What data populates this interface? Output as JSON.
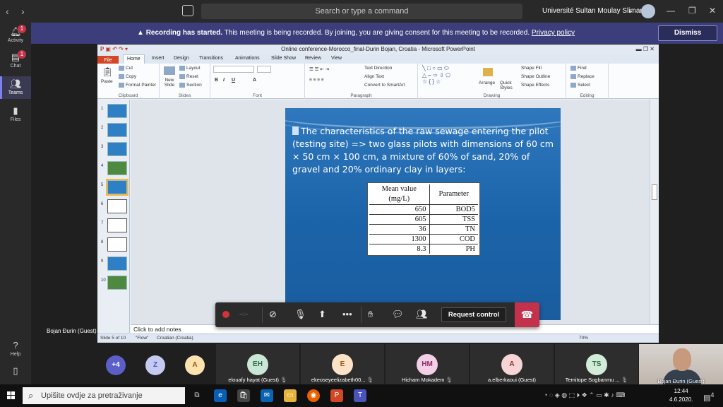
{
  "teams": {
    "search_placeholder": "Search or type a command",
    "org_name": "Université Sultan Moulay Slimane",
    "rail": [
      {
        "label": "Activity",
        "badge": "1"
      },
      {
        "label": "Chat",
        "badge": "1"
      },
      {
        "label": "Teams",
        "badge": ""
      },
      {
        "label": "Files",
        "badge": ""
      },
      {
        "label": "Help",
        "badge": ""
      }
    ]
  },
  "banner": {
    "bold": "Recording has started.",
    "text": "This meeting is being recorded. By joining, you are giving consent for this meeting to be recorded.",
    "link": "Privacy policy",
    "dismiss": "Dismiss"
  },
  "powerpoint": {
    "title": "Online conference-Morocco_final-Durin Bojan, Croatia  -  Microsoft PowerPoint",
    "tabs": [
      "File",
      "Home",
      "Insert",
      "Design",
      "Transitions",
      "Animations",
      "Slide Show",
      "Review",
      "View"
    ],
    "groups": {
      "clipboard": "Clipboard",
      "slides": "Slides",
      "font": "Font",
      "paragraph": "Paragraph",
      "drawing": "Drawing",
      "editing": "Editing"
    },
    "buttons": {
      "paste": "Paste",
      "cut": "Cut",
      "copy": "Copy",
      "format_painter": "Format Painter",
      "new_slide": "New Slide",
      "layout": "Layout",
      "reset": "Reset",
      "section": "Section",
      "text_direction": "Text Direction",
      "align_text": "Align Text",
      "convert_smartart": "Convert to SmartArt",
      "arrange": "Arrange",
      "quick_styles": "Quick Styles",
      "shape_fill": "Shape Fill",
      "shape_outline": "Shape Outline",
      "shape_effects": "Shape Effects",
      "find": "Find",
      "replace": "Replace",
      "select": "Select"
    },
    "slide_numbers": [
      "1",
      "2",
      "3",
      "4",
      "5",
      "6",
      "7",
      "8",
      "9",
      "10"
    ],
    "slide": {
      "text": "The characteristics of the raw sewage entering the pilot (testing site) => two glass pilots with dimensions of 60 cm × 50 cm × 100 cm, a mixture of 60% of sand, 20% of gravel and 20% ordinary clay in layers:",
      "table_headers": [
        "Mean value (mg/L)",
        "Parameter"
      ],
      "table_rows": [
        {
          "value": "650",
          "parameter": "BOD5"
        },
        {
          "value": "605",
          "parameter": "TSS"
        },
        {
          "value": "36",
          "parameter": "TN"
        },
        {
          "value": "1300",
          "parameter": "COD"
        },
        {
          "value": "8.3",
          "parameter": "PH"
        }
      ]
    },
    "notes_placeholder": "Click to add notes",
    "status": {
      "slide_of": "Slide 5 of 10",
      "theme": "\"Flow\"",
      "language": "Croatian (Croatia)",
      "zoom": "70%"
    }
  },
  "call": {
    "timer": "--:--",
    "request_control": "Request control",
    "presenter_name": "Bojan Đurin (Guest)"
  },
  "participants": {
    "overflow": "+4",
    "chips": [
      {
        "initials": "Z",
        "color": "#c5cbf0"
      },
      {
        "initials": "A",
        "color": "#fde2b0"
      }
    ],
    "tiles": [
      {
        "initials": "EH",
        "name": "elouafy hayat (Guest)",
        "color": "#c9e6d6"
      },
      {
        "initials": "E",
        "name": "ekeoseyeelizabeth00...",
        "color": "#fde2c8"
      },
      {
        "initials": "HM",
        "name": "Hicham Mokadem",
        "color": "#f3d0e6"
      },
      {
        "initials": "A",
        "name": "a.elberkaoui (Guest)",
        "color": "#f7d4d6"
      },
      {
        "initials": "TS",
        "name": "Temitope Sogbanmu ...",
        "color": "#d3ecd9"
      }
    ],
    "self_name": "Bojan Đurin (Guest)"
  },
  "taskbar": {
    "search_placeholder": "Upišite ovdje za pretraživanje",
    "time": "12:44",
    "date": "4.6.2020.",
    "notifications": "4"
  }
}
